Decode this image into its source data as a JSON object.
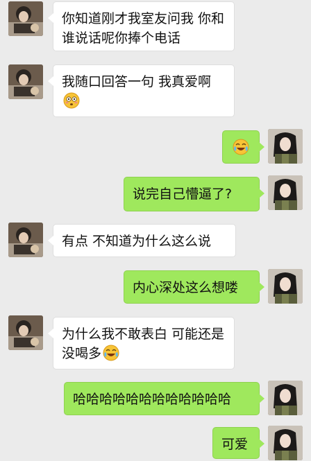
{
  "messages": [
    {
      "side": "left",
      "text": "你知道刚才我室友问我 你和谁说话呢你捧个电话",
      "emoji": ""
    },
    {
      "side": "left",
      "text": "我随口回答一句 我真爱啊",
      "emoji": "flushed-face-emoji"
    },
    {
      "side": "right",
      "text": "",
      "emoji": "tears-of-joy-emoji"
    },
    {
      "side": "right",
      "text": "说完自己懵逼了?",
      "emoji": ""
    },
    {
      "side": "left",
      "text": "有点 不知道为什么这么说",
      "emoji": ""
    },
    {
      "side": "right",
      "text": "内心深处这么想喽",
      "emoji": ""
    },
    {
      "side": "left",
      "text": "为什么我不敢表白 可能还是没喝多",
      "emoji": "tears-of-joy-emoji"
    },
    {
      "side": "right",
      "text": "哈哈哈哈哈哈哈哈哈哈哈哈",
      "emoji": ""
    },
    {
      "side": "right",
      "text": "可爱",
      "emoji": ""
    }
  ],
  "colors": {
    "background": "#ebebeb",
    "outgoing_bubble": "#9fe85d",
    "incoming_bubble": "#ffffff"
  }
}
